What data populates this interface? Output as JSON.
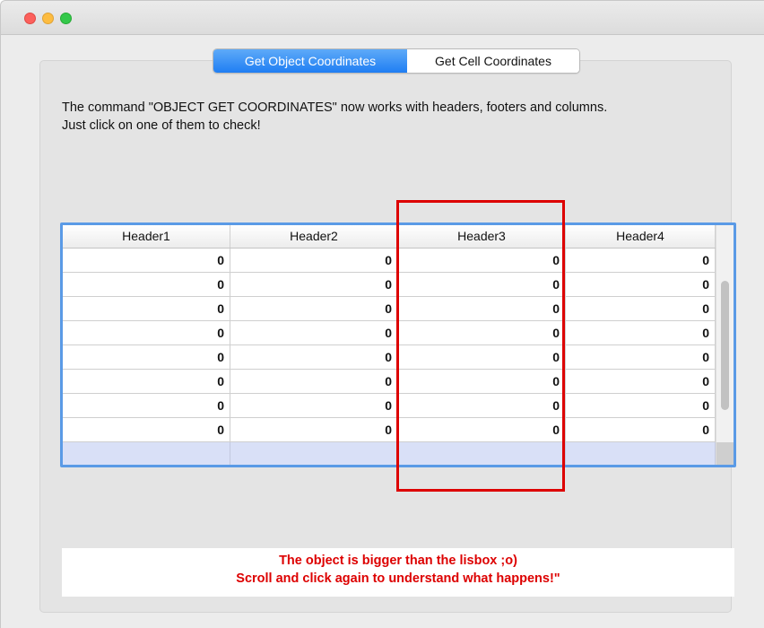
{
  "window": {
    "controls": [
      "close",
      "minimize",
      "zoom"
    ]
  },
  "tabs": [
    {
      "label": "Get Object Coordinates",
      "selected": true
    },
    {
      "label": "Get Cell Coordinates",
      "selected": false
    }
  ],
  "description": {
    "line1": "The command \"OBJECT GET COORDINATES\" now works with headers, footers and columns.",
    "line2": "Just click on one of them to check!"
  },
  "listbox": {
    "headers": [
      "Header1",
      "Header2",
      "Header3",
      "Header4"
    ],
    "rows": [
      [
        "0",
        "0",
        "0",
        "0"
      ],
      [
        "0",
        "0",
        "0",
        "0"
      ],
      [
        "0",
        "0",
        "0",
        "0"
      ],
      [
        "0",
        "0",
        "0",
        "0"
      ],
      [
        "0",
        "0",
        "0",
        "0"
      ],
      [
        "0",
        "0",
        "0",
        "0"
      ],
      [
        "0",
        "0",
        "0",
        "0"
      ],
      [
        "0",
        "0",
        "0",
        "0"
      ]
    ],
    "footer": [
      "",
      "",
      "",
      ""
    ],
    "colors": {
      "focus_border": "#5a9ae6",
      "footer_bg": "#d9e0f7"
    }
  },
  "highlight": {
    "target_column": "Header3",
    "color": "#dd0000"
  },
  "message": {
    "line1": "The object is bigger than the lisbox ;o)",
    "line2": "Scroll and click again to understand what happens!\"",
    "color": "#dd0000"
  }
}
